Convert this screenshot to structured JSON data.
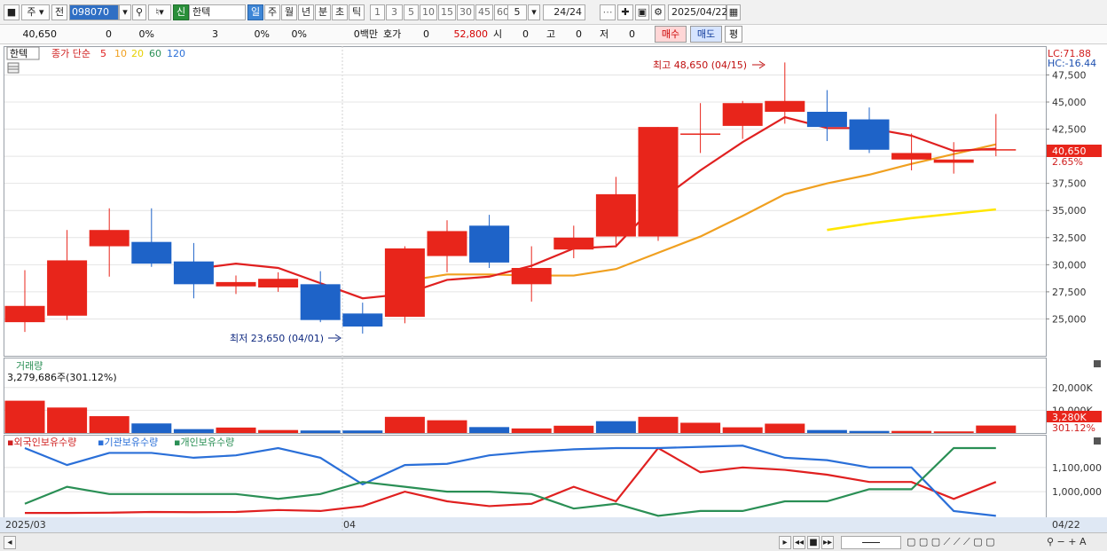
{
  "toolbar": {
    "period_type": "주",
    "prev_label": "전",
    "stock_code": "098070",
    "credit_badge": "신",
    "stock_name": "한텍",
    "period_tabs": [
      "일",
      "주",
      "월",
      "년",
      "분",
      "초",
      "틱"
    ],
    "active_tab": "일",
    "interval_numbers": [
      "1",
      "3",
      "5",
      "10",
      "15",
      "30",
      "45",
      "60"
    ],
    "custom_interval": "5",
    "count": "24/24",
    "date": "2025/04/22"
  },
  "quote": {
    "price": "40,650",
    "change": "0",
    "change_pct": "0%",
    "volume": "3",
    "v1": "0%",
    "v2": "0%",
    "amount_label": "0백만",
    "hoga_label": "호가",
    "hoga_value": "0",
    "ask_price": "52,800",
    "open_label": "시",
    "open_value": "0",
    "high_label": "고",
    "high_value": "0",
    "low_label": "저",
    "low_value": "0",
    "buy_label": "매수",
    "sell_label": "매도",
    "flat_label": "평"
  },
  "main_chart": {
    "stock_tag": "한텍",
    "legend_title": "종가 단순",
    "ma_labels": [
      "5",
      "10",
      "20",
      "60",
      "120"
    ],
    "lc_label": "LC:71.88",
    "hc_label": "HC:-16.44",
    "last_price_label": "40,650",
    "last_pct_label": "2.65%",
    "high_annotation": "최고 48,650 (04/15)",
    "low_annotation": "최저 23,650 (04/01)"
  },
  "volume_panel": {
    "title": "거래량",
    "value_label": "3,279,686주(301.12%)",
    "last_label": "3,280K",
    "last_pct": "301.12%"
  },
  "holdings_panel": {
    "labels": [
      "외국인보유수량",
      "기관보유수량",
      "개인보유수량"
    ]
  },
  "xaxis": {
    "left": "2025/03",
    "mid": "04",
    "right": "04/22"
  },
  "colors": {
    "up": "#e8251b",
    "down": "#1e63c8",
    "ma5": "#e02020",
    "ma10": "#f0a020",
    "ma20": "#ffe600",
    "foreign": "#e02020",
    "inst": "#2a6fd8",
    "retail": "#2a8f55"
  },
  "chart_data": {
    "type": "candlestick",
    "ylim": [
      22500,
      49500
    ],
    "yticks": [
      25000,
      27500,
      30000,
      32500,
      35000,
      37500,
      40000,
      42500,
      45000,
      47500
    ],
    "ytick_labels": [
      "25,000",
      "27,500",
      "30,000",
      "32,500",
      "35,000",
      "37,500",
      "",
      "42,500",
      "45,000",
      "47,500"
    ],
    "candles": [
      {
        "o": 24700,
        "h": 29500,
        "l": 23800,
        "c": 26200
      },
      {
        "o": 25300,
        "h": 33200,
        "l": 24900,
        "c": 30400
      },
      {
        "o": 31700,
        "h": 35200,
        "l": 28900,
        "c": 33200
      },
      {
        "o": 32100,
        "h": 35200,
        "l": 29800,
        "c": 30100
      },
      {
        "o": 30300,
        "h": 32000,
        "l": 26900,
        "c": 28200
      },
      {
        "o": 28000,
        "h": 29000,
        "l": 27300,
        "c": 28400
      },
      {
        "o": 27900,
        "h": 29300,
        "l": 27500,
        "c": 28700
      },
      {
        "o": 28200,
        "h": 29400,
        "l": 24700,
        "c": 24900
      },
      {
        "o": 25500,
        "h": 26500,
        "l": 23650,
        "c": 24300
      },
      {
        "o": 25200,
        "h": 31700,
        "l": 24600,
        "c": 31500
      },
      {
        "o": 30800,
        "h": 34100,
        "l": 29300,
        "c": 33100
      },
      {
        "o": 33600,
        "h": 34600,
        "l": 29700,
        "c": 30200
      },
      {
        "o": 28200,
        "h": 31700,
        "l": 26600,
        "c": 29700
      },
      {
        "o": 31400,
        "h": 33600,
        "l": 30600,
        "c": 32500
      },
      {
        "o": 32600,
        "h": 38100,
        "l": 31600,
        "c": 36500
      },
      {
        "o": 32600,
        "h": 42700,
        "l": 32200,
        "c": 42700
      },
      {
        "o": 42100,
        "h": 44900,
        "l": 40300,
        "c": 42100
      },
      {
        "o": 42800,
        "h": 45100,
        "l": 41600,
        "c": 44900
      },
      {
        "o": 44100,
        "h": 48650,
        "l": 43000,
        "c": 45100
      },
      {
        "o": 44100,
        "h": 46100,
        "l": 41400,
        "c": 42700
      },
      {
        "o": 43400,
        "h": 44500,
        "l": 40300,
        "c": 40600
      },
      {
        "o": 39700,
        "h": 42100,
        "l": 38700,
        "c": 40300
      },
      {
        "o": 39400,
        "h": 41300,
        "l": 38400,
        "c": 39700
      },
      {
        "o": 40650,
        "h": 43900,
        "l": 40000,
        "c": 40650
      }
    ],
    "ma5": [
      null,
      null,
      null,
      null,
      29600,
      30100,
      29700,
      28300,
      26900,
      27300,
      28600,
      28900,
      29900,
      31500,
      31700,
      35800,
      38700,
      41300,
      43600,
      42600,
      42600,
      41900,
      40500,
      40700
    ],
    "ma10": [
      null,
      null,
      null,
      null,
      null,
      null,
      null,
      null,
      null,
      28500,
      29100,
      29100,
      29000,
      29000,
      29600,
      31100,
      32600,
      34500,
      36500,
      37500,
      38300,
      39300,
      40200,
      41100
    ],
    "ma20": [
      null,
      null,
      null,
      null,
      null,
      null,
      null,
      null,
      null,
      null,
      null,
      null,
      null,
      null,
      null,
      null,
      null,
      null,
      null,
      33200,
      33800,
      34300,
      34700,
      35100
    ],
    "volume": {
      "ylim": [
        0,
        32000
      ],
      "yticks": [
        10000,
        20000
      ],
      "ytick_labels": [
        "10,000K",
        "20,000K"
      ],
      "values": [
        14200,
        11200,
        7400,
        4200,
        1700,
        2400,
        1300,
        1100,
        1100,
        7100,
        5600,
        2600,
        2000,
        3200,
        5200,
        7100,
        4500,
        2500,
        4100,
        1300,
        900,
        900,
        700,
        3280
      ],
      "up": [
        true,
        true,
        true,
        false,
        false,
        true,
        true,
        false,
        false,
        true,
        true,
        false,
        true,
        true,
        false,
        true,
        true,
        true,
        true,
        false,
        false,
        true,
        true,
        true
      ]
    },
    "holdings": {
      "ylim": [
        905000,
        1180000
      ],
      "yticks": [
        1000000,
        1100000
      ],
      "ytick_labels": [
        "1,000,000",
        "1,100,000"
      ],
      "series": [
        {
          "name": "외국인보유수량",
          "values": [
            912000,
            912000,
            913000,
            916000,
            915000,
            916000,
            924000,
            920000,
            940000,
            1000000,
            960000,
            940000,
            950000,
            1020000,
            960000,
            1180000,
            1080000,
            1100000,
            1090000,
            1070000,
            1040000,
            1040000,
            970000,
            1040000
          ]
        },
        {
          "name": "기관보유수량",
          "values": [
            1180000,
            1110000,
            1160000,
            1160000,
            1140000,
            1150000,
            1180000,
            1140000,
            1030000,
            1110000,
            1115000,
            1150000,
            1165000,
            1175000,
            1180000,
            1180000,
            1185000,
            1190000,
            1140000,
            1130000,
            1100000,
            1100000,
            920000,
            900000
          ]
        },
        {
          "name": "개인보유수량",
          "values": [
            950000,
            1020000,
            990000,
            990000,
            990000,
            990000,
            970000,
            990000,
            1040000,
            1020000,
            1000000,
            1000000,
            990000,
            930000,
            950000,
            900000,
            920000,
            920000,
            960000,
            960000,
            1010000,
            1010000,
            1180000,
            1180000
          ]
        }
      ]
    }
  }
}
